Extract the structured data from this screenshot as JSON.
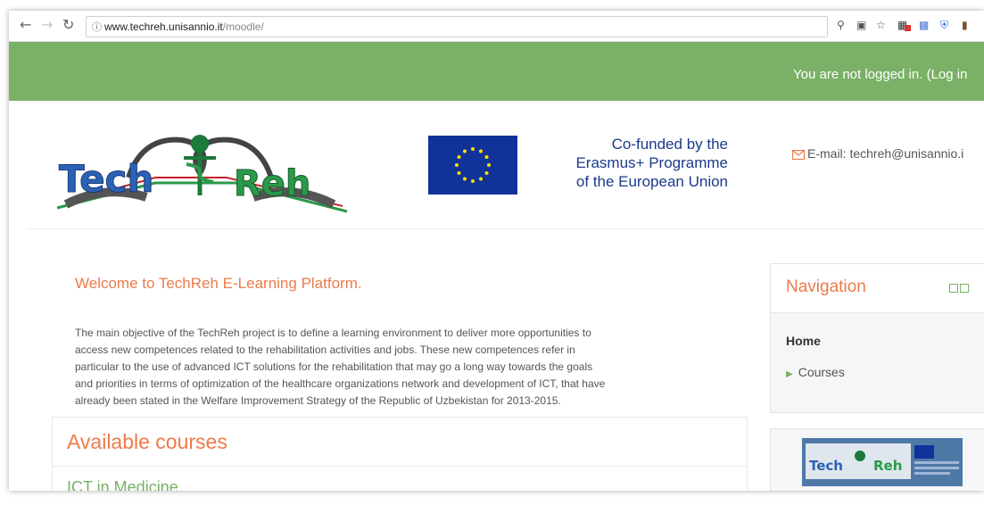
{
  "browser": {
    "url_host": "www.techreh.unisannio.it",
    "url_path": "/moodle/"
  },
  "header": {
    "login_message": "You are not logged in. (Log in",
    "logo_text_left": "Tech",
    "logo_text_right": "Reh",
    "eu_text": [
      "Co-funded by the",
      "Erasmus+ Programme",
      "of the European Union"
    ],
    "email": "E-mail: techreh@unisannio.i"
  },
  "main": {
    "welcome_title": "Welcome to TechReh E-Learning Platform.",
    "intro_lines": [
      "The main objective of the TechReh project is to define a learning environment to deliver more opportunities to",
      "access new competences related to the rehabilitation activities and jobs. These new competences refer in",
      "particular to the use of advanced ICT solutions for the rehabilitation that may go a long way towards the goals",
      "and priorities in terms of optimization of the healthcare organizations network and development of ICT, that have",
      "already been stated in the Welfare Improvement Strategy of the Republic of Uzbekistan for 2013-2015."
    ],
    "available_courses_title": "Available courses",
    "first_course": "ICT in Medicine"
  },
  "navigation": {
    "title": "Navigation",
    "home": "Home",
    "courses": "Courses"
  },
  "colors": {
    "green": "#7ab166",
    "orange": "#ec7b4a",
    "eu_blue": "#113399",
    "eu_text": "#1b3a8c"
  }
}
